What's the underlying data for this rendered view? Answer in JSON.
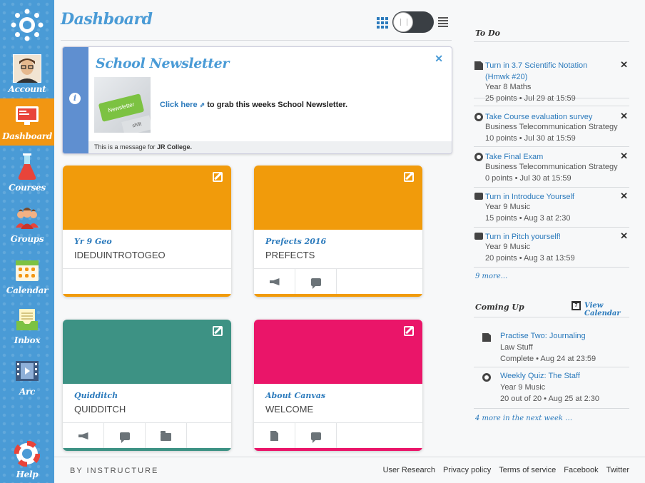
{
  "nav": {
    "items": [
      {
        "label": "Account",
        "icon": "avatar"
      },
      {
        "label": "Dashboard",
        "icon": "dashboard-icon"
      },
      {
        "label": "Courses",
        "icon": "flask-icon"
      },
      {
        "label": "Groups",
        "icon": "groups-icon"
      },
      {
        "label": "Calendar",
        "icon": "calendar-icon"
      },
      {
        "label": "Inbox",
        "icon": "inbox-icon"
      },
      {
        "label": "Arc",
        "icon": "film-icon"
      },
      {
        "label": "Help",
        "icon": "lifebuoy-icon"
      }
    ],
    "active": "Dashboard",
    "colors": {
      "bg": "#4a9bd6",
      "active": "#f29612"
    }
  },
  "header": {
    "title": "Dashboard",
    "view": "card"
  },
  "newsletter": {
    "title": "School Newsletter",
    "link_text": "Click here",
    "text": "to grab this weeks School Newsletter.",
    "footer_prefix": "This is a message for",
    "footer_school": "JR College.",
    "image_key_label": "Newsletter",
    "image_key2_label": "shift"
  },
  "cards": [
    {
      "name": "Yr 9 Geo",
      "code": "IDEDUINTROTOGEO",
      "color": "#f19b0b",
      "actions": []
    },
    {
      "name": "Prefects 2016",
      "code": "PREFECTS",
      "color": "#f19b0b",
      "actions": [
        "announcement-icon",
        "discussion-icon"
      ]
    },
    {
      "name": "Quidditch",
      "code": "QUIDDITCH",
      "color": "#3d9284",
      "actions": [
        "announcement-icon",
        "discussion-icon",
        "folder-icon"
      ]
    },
    {
      "name": "About Canvas",
      "code": "WELCOME",
      "color": "#ea1569",
      "actions": [
        "assignment-icon",
        "discussion-icon"
      ]
    }
  ],
  "todo": {
    "heading": "To Do",
    "items": [
      {
        "type": "assignment-icon",
        "title": "Turn in 3.7 Scientific Notation (Hmwk #20)",
        "course": "Year 8 Maths",
        "meta": "25 points • Jul 29 at 15:59"
      },
      {
        "type": "quiz-icon",
        "title": "Take Course evaluation survey",
        "course": "Business Telecommunication Strategy",
        "meta": "10 points • Jul 30 at 15:59"
      },
      {
        "type": "quiz-icon",
        "title": "Take Final Exam",
        "course": "Business Telecommunication Strategy",
        "meta": "0 points • Jul 30 at 15:59"
      },
      {
        "type": "discussion-icon",
        "title": "Turn in Introduce Yourself",
        "course": "Year 9 Music",
        "meta": "15 points • Aug 3 at 2:30"
      },
      {
        "type": "discussion-icon",
        "title": "Turn in Pitch yourself!",
        "course": "Year 9 Music",
        "meta": "20 points • Aug 3 at 13:59"
      }
    ],
    "more": "9 more..."
  },
  "coming_up": {
    "heading": "Coming Up",
    "calendar_link": "View Calendar",
    "calendar_day": "7",
    "items": [
      {
        "type": "assignment-icon",
        "title": "Practise Two: Journaling",
        "course": "Law Stuff",
        "meta": "Complete • Aug 24 at 23:59"
      },
      {
        "type": "quiz-icon",
        "title": "Weekly Quiz: The Staff",
        "course": "Year 9 Music",
        "meta": "20 out of 20 • Aug 25 at 2:30"
      }
    ],
    "more": "4 more in the next week …"
  },
  "footer": {
    "brand": "BY INSTRUCTURE",
    "links": [
      "User Research",
      "Privacy policy",
      "Terms of service",
      "Facebook",
      "Twitter"
    ]
  }
}
